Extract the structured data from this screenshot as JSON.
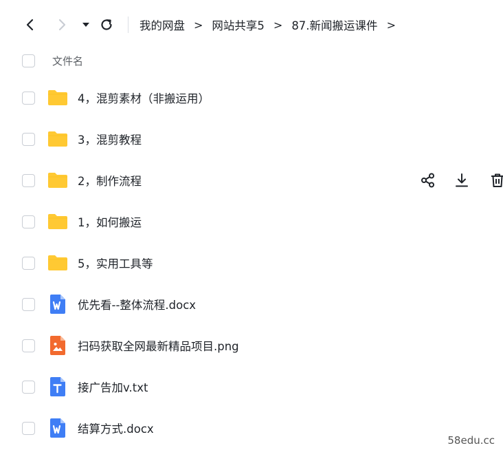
{
  "breadcrumb": {
    "items": [
      "我的网盘",
      "网站共享5",
      "87.新闻搬运课件"
    ],
    "separator": ">"
  },
  "list_header": {
    "name_label": "文件名"
  },
  "files": [
    {
      "name": "4，混剪素材（非搬运用）",
      "icon": "folder-icon"
    },
    {
      "name": "3，混剪教程",
      "icon": "folder-icon"
    },
    {
      "name": "2，制作流程",
      "icon": "folder-icon"
    },
    {
      "name": "1，如何搬运",
      "icon": "folder-icon"
    },
    {
      "name": "5，实用工具等",
      "icon": "folder-icon"
    },
    {
      "name": "优先看--整体流程.docx",
      "icon": "word-doc-icon"
    },
    {
      "name": "扫码获取全网最新精品项目.png",
      "icon": "image-file-icon"
    },
    {
      "name": "接广告加v.txt",
      "icon": "text-file-icon"
    },
    {
      "name": "结算方式.docx",
      "icon": "word-doc-icon"
    }
  ],
  "hovered_row_index": 2,
  "colors": {
    "folder": "#ffc933",
    "word": "#3f7ef5",
    "image": "#f26a2e",
    "text": "#3f7ef5",
    "checkbox_border": "#c9cdd4"
  },
  "watermark": "58edu.cc"
}
